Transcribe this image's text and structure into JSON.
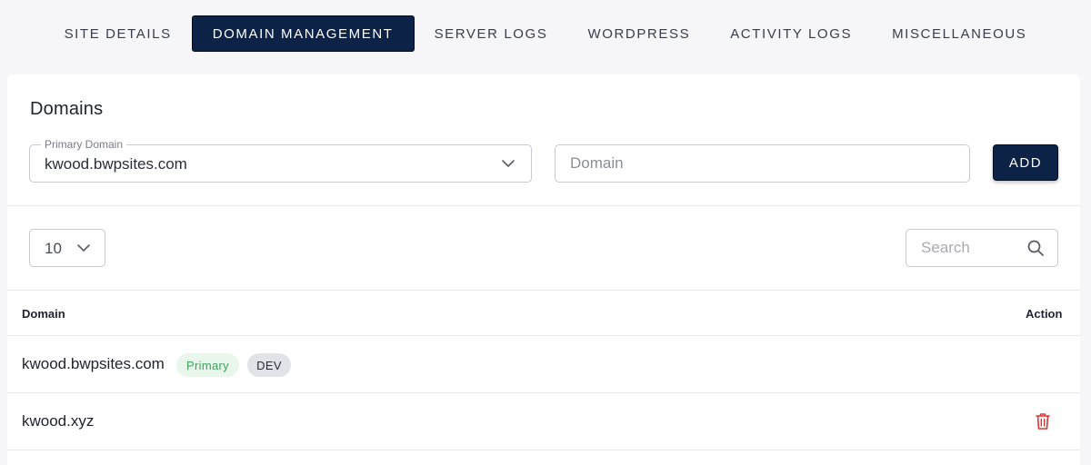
{
  "tabs": [
    {
      "label": "SITE DETAILS",
      "active": false
    },
    {
      "label": "DOMAIN MANAGEMENT",
      "active": true
    },
    {
      "label": "SERVER LOGS",
      "active": false
    },
    {
      "label": "WORDPRESS",
      "active": false
    },
    {
      "label": "ACTIVITY LOGS",
      "active": false
    },
    {
      "label": "MISCELLANEOUS",
      "active": false
    }
  ],
  "domains_card": {
    "title": "Domains",
    "primary_domain": {
      "legend": "Primary Domain",
      "value": "kwood.bwpsites.com"
    },
    "domain_input": {
      "value": "",
      "placeholder": "Domain"
    },
    "add_label": "ADD"
  },
  "table_controls": {
    "per_page": "10",
    "search": {
      "value": "",
      "placeholder": "Search"
    }
  },
  "table": {
    "columns": [
      "Domain",
      "Action"
    ],
    "rows": [
      {
        "domain": "kwood.bwpsites.com",
        "badges": [
          "Primary",
          "DEV"
        ],
        "action": ""
      },
      {
        "domain": "kwood.xyz",
        "badges": [],
        "action": "trash-icon"
      }
    ]
  },
  "colors": {
    "accent": "#0c2347",
    "primary_badge_bg": "#e8f6ec",
    "primary_badge_text": "#3aa55a",
    "delete_red": "#d93535"
  },
  "icons": [
    "chevron-down-icon",
    "search-icon",
    "trash-icon"
  ]
}
